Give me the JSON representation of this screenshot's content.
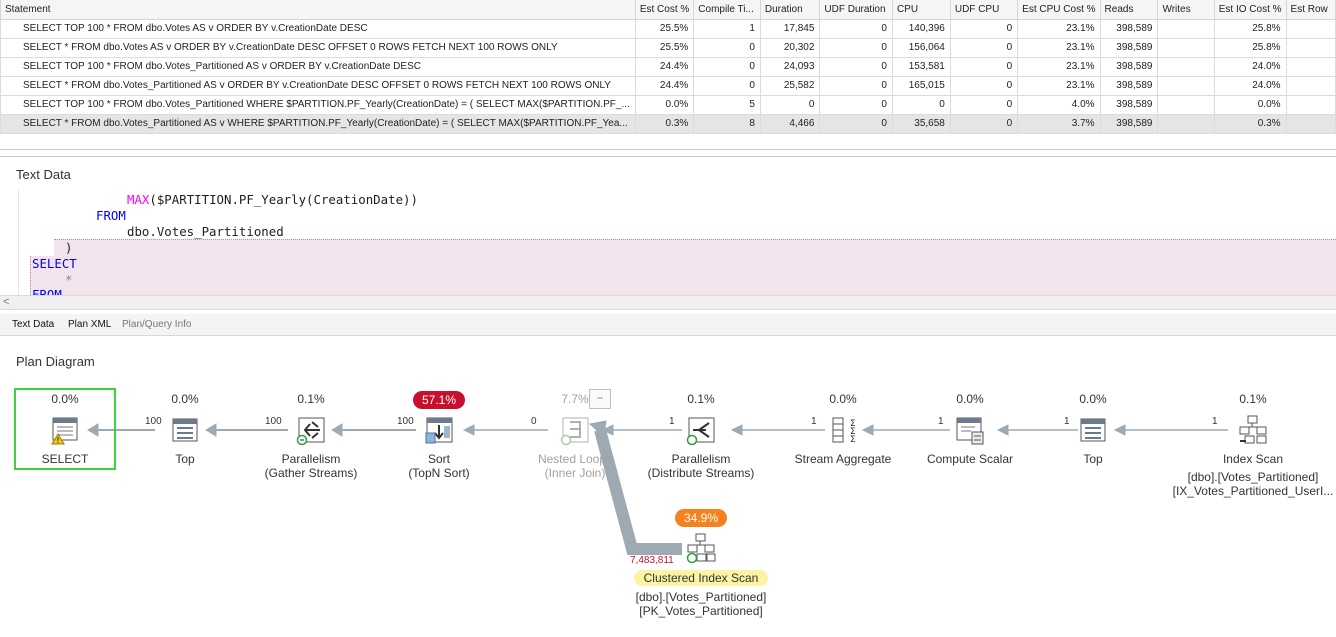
{
  "grid": {
    "columns": [
      "Statement",
      "Est Cost %",
      "Compile Ti...",
      "Duration",
      "UDF Duration",
      "CPU",
      "UDF CPU",
      "Est CPU Cost %",
      "Reads",
      "Writes",
      "Est IO Cost %",
      "Est Row"
    ],
    "rows": [
      {
        "statement": "SELECT TOP 100 * FROM dbo.Votes AS v ORDER BY v.CreationDate DESC",
        "est_cost": "25.5%",
        "compile": "1",
        "duration": "17,845",
        "udf_duration": "0",
        "cpu": "140,396",
        "udf_cpu": "0",
        "est_cpu": "23.1%",
        "reads": "398,589",
        "writes": "",
        "est_io": "25.8%"
      },
      {
        "statement": "SELECT * FROM dbo.Votes AS v ORDER BY v.CreationDate DESC OFFSET 0 ROWS FETCH NEXT 100 ROWS ONLY",
        "est_cost": "25.5%",
        "compile": "0",
        "duration": "20,302",
        "udf_duration": "0",
        "cpu": "156,064",
        "udf_cpu": "0",
        "est_cpu": "23.1%",
        "reads": "398,589",
        "writes": "",
        "est_io": "25.8%"
      },
      {
        "statement": "SELECT TOP 100 * FROM dbo.Votes_Partitioned AS v ORDER BY v.CreationDate DESC",
        "est_cost": "24.4%",
        "compile": "0",
        "duration": "24,093",
        "udf_duration": "0",
        "cpu": "153,581",
        "udf_cpu": "0",
        "est_cpu": "23.1%",
        "reads": "398,589",
        "writes": "",
        "est_io": "24.0%"
      },
      {
        "statement": "SELECT * FROM dbo.Votes_Partitioned AS v ORDER BY v.CreationDate DESC OFFSET 0 ROWS FETCH NEXT 100 ROWS ONLY",
        "est_cost": "24.4%",
        "compile": "0",
        "duration": "25,582",
        "udf_duration": "0",
        "cpu": "165,015",
        "udf_cpu": "0",
        "est_cpu": "23.1%",
        "reads": "398,589",
        "writes": "",
        "est_io": "24.0%"
      },
      {
        "statement": "SELECT TOP 100 * FROM dbo.Votes_Partitioned WHERE $PARTITION.PF_Yearly(CreationDate) = ( SELECT MAX($PARTITION.PF_...",
        "est_cost": "0.0%",
        "compile": "5",
        "duration": "0",
        "udf_duration": "0",
        "cpu": "0",
        "udf_cpu": "0",
        "est_cpu": "4.0%",
        "reads": "398,589",
        "writes": "",
        "est_io": "0.0%"
      },
      {
        "statement": "SELECT * FROM dbo.Votes_Partitioned AS v WHERE $PARTITION.PF_Yearly(CreationDate) = ( SELECT MAX($PARTITION.PF_Yea...",
        "est_cost": "0.3%",
        "compile": "8",
        "duration": "4,466",
        "udf_duration": "0",
        "cpu": "35,658",
        "udf_cpu": "0",
        "est_cpu": "3.7%",
        "reads": "398,589",
        "writes": "",
        "est_io": "0.3%"
      }
    ]
  },
  "text_panel": {
    "title": "Text Data",
    "lines": {
      "l1_fn": "MAX",
      "l1_rest": "($PARTITION.PF_Yearly(CreationDate))",
      "l2": "FROM",
      "l3": "dbo.Votes_Partitioned",
      "l4": ")",
      "l5": "SELECT",
      "l6": "*",
      "l7": "FROM"
    },
    "scroll_arrow": "<"
  },
  "tabs": [
    "Text Data",
    "Plan XML",
    "Plan/Query Info"
  ],
  "plan": {
    "title": "Plan Diagram",
    "collapse_label": "−",
    "nodes": [
      {
        "cost": "0.0%",
        "label": "SELECT",
        "sub": ""
      },
      {
        "cost": "0.0%",
        "label": "Top",
        "sub": ""
      },
      {
        "cost": "0.1%",
        "label": "Parallelism",
        "sub": "(Gather Streams)"
      },
      {
        "cost": "57.1%",
        "label": "Sort",
        "sub": "(TopN Sort)"
      },
      {
        "cost": "7.7%",
        "label": "Nested Loops",
        "sub": "(Inner Join)"
      },
      {
        "cost": "0.1%",
        "label": "Parallelism",
        "sub": "(Distribute Streams)"
      },
      {
        "cost": "0.0%",
        "label": "Stream Aggregate",
        "sub": ""
      },
      {
        "cost": "0.0%",
        "label": "Compute Scalar",
        "sub": ""
      },
      {
        "cost": "0.0%",
        "label": "Top",
        "sub": ""
      },
      {
        "cost": "0.1%",
        "label": "Index Scan",
        "sub": "[dbo].[Votes_Partitioned]",
        "sub2": "[IX_Votes_Partitioned_UserI..."
      },
      {
        "cost": "34.9%",
        "label": "Clustered Index Scan",
        "sub": "[dbo].[Votes_Partitioned]",
        "sub2": "[PK_Votes_Partitioned]"
      }
    ],
    "row_counts": [
      "100",
      "100",
      "100",
      "0",
      "1",
      "1",
      "1",
      "1",
      "1",
      "7,483,811"
    ]
  },
  "colors": {
    "badge_red": "#c8102e",
    "badge_orange": "#f5821f",
    "select_highlight": "#3ed13e",
    "keyword": "#0000ff",
    "function": "#ff00ff"
  }
}
